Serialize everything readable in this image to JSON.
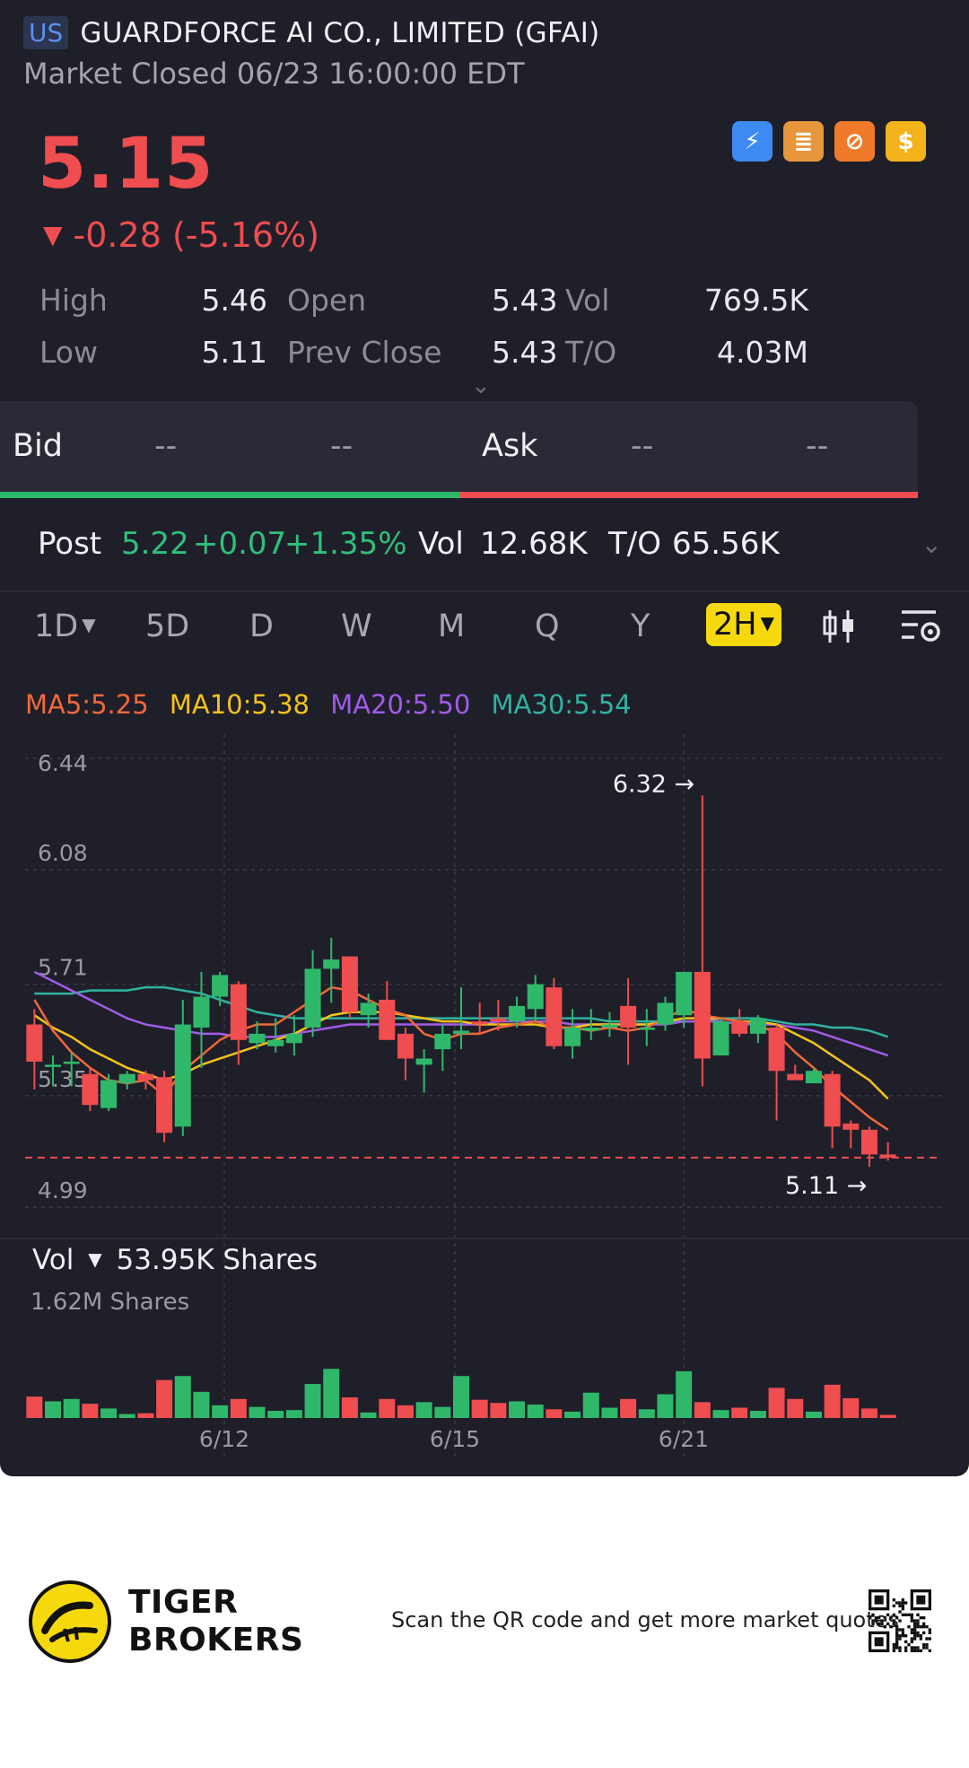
{
  "header": {
    "region": "US",
    "company": "GUARDFORCE AI CO., LIMITED (GFAI)",
    "status": "Market Closed 06/23 16:00:00 EDT"
  },
  "quote": {
    "price": "5.15",
    "change_arrow": "▼",
    "change": "-0.28 (-5.16%)",
    "color_down": "#ef4d4f",
    "color_up": "#2fb86a"
  },
  "badges": [
    {
      "icon": "lightning-1-icon",
      "glyph": "⚡",
      "color": "#3d8bf2"
    },
    {
      "icon": "stack-a-icon",
      "glyph": "≣",
      "color": "#e8963b"
    },
    {
      "icon": "crossed-circle-icon",
      "glyph": "⊘",
      "color": "#f07a2a"
    },
    {
      "icon": "dollar-icon",
      "glyph": "$",
      "color": "#f4b31a"
    }
  ],
  "stats": {
    "row1": [
      {
        "label": "High",
        "value": "5.46"
      },
      {
        "label": "Open",
        "value": "5.43"
      },
      {
        "label": "Vol",
        "value": "769.5K"
      }
    ],
    "row2": [
      {
        "label": "Low",
        "value": "5.11"
      },
      {
        "label": "Prev Close",
        "value": "5.43"
      },
      {
        "label": "T/O",
        "value": "4.03M"
      }
    ]
  },
  "bidask": {
    "bid_label": "Bid",
    "bid_price": "--",
    "bid_size": "--",
    "ask_label": "Ask",
    "ask_price": "--",
    "ask_size": "--"
  },
  "post": {
    "label": "Post",
    "price": "5.22",
    "change": "+0.07",
    "pct": "+1.35%",
    "vol_label": "Vol",
    "vol": "12.68K",
    "to_label": "T/O",
    "to": "65.56K"
  },
  "periods": [
    {
      "label": "1D",
      "dropdown": true
    },
    {
      "label": "5D"
    },
    {
      "label": "D"
    },
    {
      "label": "W"
    },
    {
      "label": "M"
    },
    {
      "label": "Q"
    },
    {
      "label": "Y"
    },
    {
      "label": "2H",
      "dropdown": true,
      "active": true
    }
  ],
  "ma": {
    "ma5": {
      "text": "MA5:5.25",
      "color": "#f0693a"
    },
    "ma10": {
      "text": "MA10:5.38",
      "color": "#f4c21c"
    },
    "ma20": {
      "text": "MA20:5.50",
      "color": "#a25be8"
    },
    "ma30": {
      "text": "MA30:5.54",
      "color": "#2fb3a0"
    }
  },
  "chart_data": {
    "type": "candlestick",
    "y_ticks": [
      "6.44",
      "6.08",
      "5.71",
      "5.35",
      "4.99"
    ],
    "ylim": [
      4.99,
      6.44
    ],
    "x_ticks": [
      "6/12",
      "6/15",
      "6/21"
    ],
    "high_label": "6.32",
    "low_label": "5.11",
    "prev_close_line": 5.15,
    "candles": [
      {
        "o": 5.58,
        "c": 5.46,
        "h": 5.63,
        "l": 5.37
      },
      {
        "o": 5.45,
        "c": 5.45,
        "h": 5.48,
        "l": 5.38
      },
      {
        "o": 5.46,
        "c": 5.46,
        "h": 5.49,
        "l": 5.38
      },
      {
        "o": 5.42,
        "c": 5.32,
        "h": 5.44,
        "l": 5.3
      },
      {
        "o": 5.31,
        "c": 5.4,
        "h": 5.42,
        "l": 5.3
      },
      {
        "o": 5.39,
        "c": 5.42,
        "h": 5.43,
        "l": 5.37
      },
      {
        "o": 5.42,
        "c": 5.4,
        "h": 5.43,
        "l": 5.37
      },
      {
        "o": 5.41,
        "c": 5.23,
        "h": 5.43,
        "l": 5.2
      },
      {
        "o": 5.25,
        "c": 5.58,
        "h": 5.66,
        "l": 5.22
      },
      {
        "o": 5.57,
        "c": 5.67,
        "h": 5.75,
        "l": 5.44
      },
      {
        "o": 5.67,
        "c": 5.74,
        "h": 5.75,
        "l": 5.64
      },
      {
        "o": 5.71,
        "c": 5.53,
        "h": 5.72,
        "l": 5.45
      },
      {
        "o": 5.52,
        "c": 5.55,
        "h": 5.59,
        "l": 5.5
      },
      {
        "o": 5.51,
        "c": 5.53,
        "h": 5.6,
        "l": 5.49
      },
      {
        "o": 5.52,
        "c": 5.55,
        "h": 5.61,
        "l": 5.48
      },
      {
        "o": 5.57,
        "c": 5.76,
        "h": 5.82,
        "l": 5.54
      },
      {
        "o": 5.76,
        "c": 5.79,
        "h": 5.86,
        "l": 5.65
      },
      {
        "o": 5.8,
        "c": 5.62,
        "h": 5.8,
        "l": 5.6
      },
      {
        "o": 5.61,
        "c": 5.65,
        "h": 5.68,
        "l": 5.57
      },
      {
        "o": 5.66,
        "c": 5.53,
        "h": 5.72,
        "l": 5.53
      },
      {
        "o": 5.55,
        "c": 5.47,
        "h": 5.57,
        "l": 5.4
      },
      {
        "o": 5.45,
        "c": 5.47,
        "h": 5.5,
        "l": 5.36
      },
      {
        "o": 5.5,
        "c": 5.55,
        "h": 5.58,
        "l": 5.43
      },
      {
        "o": 5.55,
        "c": 5.56,
        "h": 5.7,
        "l": 5.5
      },
      {
        "o": 5.59,
        "c": 5.58,
        "h": 5.65,
        "l": 5.55
      },
      {
        "o": 5.6,
        "c": 5.59,
        "h": 5.66,
        "l": 5.56
      },
      {
        "o": 5.59,
        "c": 5.64,
        "h": 5.67,
        "l": 5.57
      },
      {
        "o": 5.63,
        "c": 5.71,
        "h": 5.74,
        "l": 5.59
      },
      {
        "o": 5.7,
        "c": 5.51,
        "h": 5.73,
        "l": 5.5
      },
      {
        "o": 5.51,
        "c": 5.57,
        "h": 5.63,
        "l": 5.47
      },
      {
        "o": 5.56,
        "c": 5.57,
        "h": 5.63,
        "l": 5.53
      },
      {
        "o": 5.57,
        "c": 5.58,
        "h": 5.62,
        "l": 5.54
      },
      {
        "o": 5.64,
        "c": 5.57,
        "h": 5.73,
        "l": 5.45
      },
      {
        "o": 5.57,
        "c": 5.57,
        "h": 5.63,
        "l": 5.51
      },
      {
        "o": 5.58,
        "c": 5.65,
        "h": 5.67,
        "l": 5.56
      },
      {
        "o": 5.61,
        "c": 5.75,
        "h": 5.75,
        "l": 5.57
      },
      {
        "o": 5.75,
        "c": 5.47,
        "h": 6.32,
        "l": 5.38
      },
      {
        "o": 5.48,
        "c": 5.59,
        "h": 5.6,
        "l": 5.48
      },
      {
        "o": 5.59,
        "c": 5.55,
        "h": 5.63,
        "l": 5.54
      },
      {
        "o": 5.55,
        "c": 5.6,
        "h": 5.61,
        "l": 5.52
      },
      {
        "o": 5.57,
        "c": 5.43,
        "h": 5.58,
        "l": 5.27
      },
      {
        "o": 5.42,
        "c": 5.4,
        "h": 5.45,
        "l": 5.4
      },
      {
        "o": 5.39,
        "c": 5.43,
        "h": 5.44,
        "l": 5.39
      },
      {
        "o": 5.42,
        "c": 5.25,
        "h": 5.43,
        "l": 5.18
      },
      {
        "o": 5.26,
        "c": 5.24,
        "h": 5.27,
        "l": 5.18
      },
      {
        "o": 5.24,
        "c": 5.16,
        "h": 5.25,
        "l": 5.12
      },
      {
        "o": 5.16,
        "c": 5.15,
        "h": 5.2,
        "l": 5.14
      }
    ],
    "ma_series": {
      "ma5": [
        5.66,
        5.56,
        5.49,
        5.44,
        5.4,
        5.39,
        5.4,
        5.35,
        5.43,
        5.48,
        5.53,
        5.56,
        5.58,
        5.58,
        5.62,
        5.66,
        5.7,
        5.69,
        5.66,
        5.63,
        5.61,
        5.55,
        5.53,
        5.55,
        5.55,
        5.57,
        5.58,
        5.59,
        5.57,
        5.57,
        5.56,
        5.57,
        5.56,
        5.57,
        5.6,
        5.63,
        5.61,
        5.6,
        5.59,
        5.58,
        5.55,
        5.49,
        5.44,
        5.38,
        5.33,
        5.28,
        5.24
      ],
      "ma10": [
        5.61,
        5.57,
        5.54,
        5.5,
        5.47,
        5.44,
        5.42,
        5.4,
        5.42,
        5.45,
        5.47,
        5.49,
        5.51,
        5.53,
        5.55,
        5.58,
        5.61,
        5.62,
        5.62,
        5.62,
        5.61,
        5.6,
        5.59,
        5.59,
        5.58,
        5.58,
        5.58,
        5.58,
        5.57,
        5.57,
        5.58,
        5.58,
        5.58,
        5.58,
        5.59,
        5.6,
        5.6,
        5.6,
        5.59,
        5.59,
        5.58,
        5.55,
        5.52,
        5.48,
        5.44,
        5.4,
        5.34
      ],
      "ma20": [
        5.75,
        5.72,
        5.69,
        5.66,
        5.63,
        5.6,
        5.58,
        5.57,
        5.56,
        5.55,
        5.55,
        5.54,
        5.54,
        5.54,
        5.55,
        5.56,
        5.57,
        5.58,
        5.58,
        5.58,
        5.58,
        5.58,
        5.58,
        5.58,
        5.58,
        5.59,
        5.59,
        5.59,
        5.59,
        5.58,
        5.58,
        5.58,
        5.58,
        5.58,
        5.58,
        5.59,
        5.59,
        5.59,
        5.58,
        5.58,
        5.58,
        5.57,
        5.56,
        5.54,
        5.52,
        5.5,
        5.48
      ],
      "ma30": [
        5.68,
        5.68,
        5.68,
        5.69,
        5.69,
        5.69,
        5.7,
        5.7,
        5.69,
        5.68,
        5.66,
        5.64,
        5.62,
        5.61,
        5.6,
        5.6,
        5.6,
        5.6,
        5.6,
        5.6,
        5.6,
        5.6,
        5.6,
        5.6,
        5.6,
        5.6,
        5.6,
        5.6,
        5.6,
        5.6,
        5.6,
        5.59,
        5.59,
        5.59,
        5.59,
        5.59,
        5.59,
        5.6,
        5.6,
        5.6,
        5.59,
        5.58,
        5.58,
        5.57,
        5.57,
        5.56,
        5.54
      ]
    },
    "volume": {
      "label": "Vol",
      "current": "53.95K Shares",
      "scale": "1.62M Shares",
      "max": 1620,
      "values_k": [
        270,
        210,
        240,
        180,
        120,
        50,
        60,
        480,
        530,
        330,
        160,
        240,
        140,
        90,
        100,
        430,
        620,
        260,
        70,
        240,
        160,
        200,
        140,
        530,
        230,
        190,
        210,
        170,
        110,
        80,
        320,
        130,
        240,
        110,
        300,
        590,
        200,
        100,
        130,
        90,
        380,
        240,
        80,
        420,
        250,
        120,
        40
      ]
    }
  },
  "footer": {
    "brand_line1": "TIGER",
    "brand_line2": "BROKERS",
    "scan_text": "Scan the QR code and get more market quotes"
  }
}
